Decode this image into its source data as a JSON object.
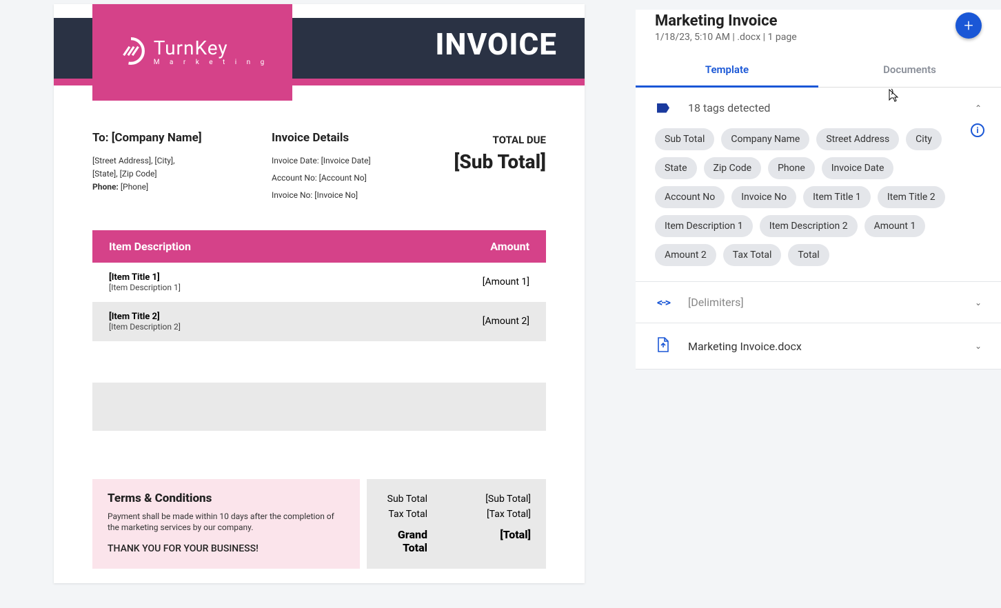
{
  "doc": {
    "brand_name": "TurnKey",
    "brand_sub": "M a r k e t i n g",
    "header_title": "INVOICE",
    "to_label": "To: [Company Name]",
    "address_line1": "[Street Address], [City],",
    "address_line2": "[State], [Zip Code]",
    "phone_label": "Phone:",
    "phone_value": "[Phone]",
    "details_title": "Invoice Details",
    "invoice_date_line": "Invoice Date: [Invoice Date]",
    "account_no_line": "Account No: [Account No]",
    "invoice_no_line": "Invoice No: [Invoice No]",
    "total_due_label": "TOTAL DUE",
    "total_due_value": "[Sub Total]",
    "col_desc": "Item Description",
    "col_amt": "Amount",
    "items": [
      {
        "title": "[Item Title 1]",
        "desc": "[Item Description 1]",
        "amount": "[Amount 1]"
      },
      {
        "title": "[Item Title 2]",
        "desc": "[Item Description 2]",
        "amount": "[Amount 2]"
      }
    ],
    "terms_title": "Terms & Conditions",
    "terms_body": "Payment shall be made within 10 days after the completion of the marketing services by our company.",
    "thanks": "THANK YOU FOR YOUR BUSINESS!",
    "sub_total_label": "Sub Total",
    "sub_total_value": "[Sub Total]",
    "tax_total_label": "Tax Total",
    "tax_total_value": "[Tax Total]",
    "grand_total_label": "Grand Total",
    "grand_total_value": "[Total]"
  },
  "panel": {
    "title": "Marketing Invoice",
    "meta": "1/18/23, 5:10 AM | .docx | 1 page",
    "tabs": {
      "template": "Template",
      "documents": "Documents"
    },
    "tags_header": "18 tags detected",
    "tags": [
      "Sub Total",
      "Company Name",
      "Street Address",
      "City",
      "State",
      "Zip Code",
      "Phone",
      "Invoice Date",
      "Account No",
      "Invoice No",
      "Item Title 1",
      "Item Title 2",
      "Item Description 1",
      "Item Description 2",
      "Amount 1",
      "Amount 2",
      "Tax Total",
      "Total"
    ],
    "delimiters_label": "[Delimiters]",
    "file_label": "Marketing Invoice.docx"
  }
}
